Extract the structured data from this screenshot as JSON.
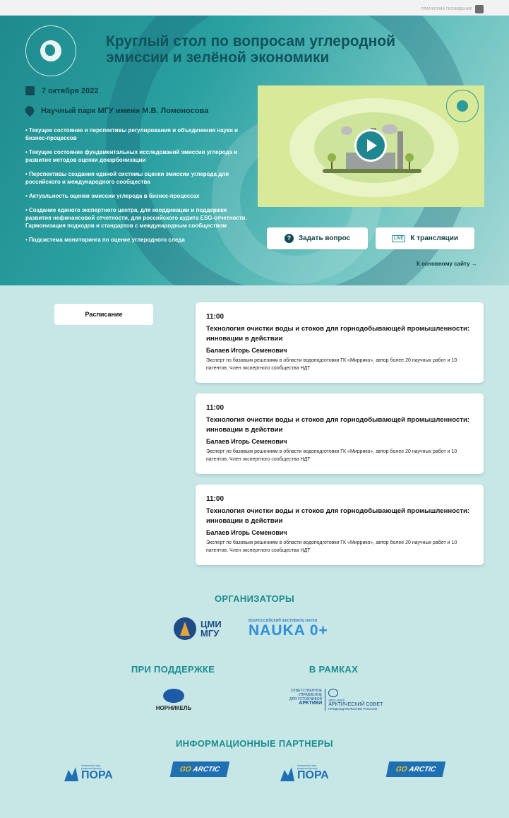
{
  "topbar": {
    "platform_label": "ПЛАТФОРМА ГЕОВИДЕНИЕ"
  },
  "hero": {
    "title": "Круглый стол по вопросам углеродной эмиссии и зелёной экономики",
    "date": "7 октября 2022",
    "place": "Научный парк МГУ имени М.В. Ломоносова",
    "bullets": [
      "Текущее состояние и перспективы регулирования и объединения науки и бизнес-процессов",
      "Текущее состояние фундаментальных исследований эмиссии углерода и развитие методов оценки декарбонизации",
      "Перспективы создания единой системы оценки эмиссии углерода для российского и международного сообщества",
      "Актуальность оценки эмиссии углерода в бизнес-процессах",
      "Создание единого экспертного центра, для координации и поддержки развития нефинансовой отчетности, для российского аудита ESG-отчетности. Гармонизация подходов и стандартов с международным сообществом",
      "Подсистема мониторинга по оценке углеродного следа"
    ],
    "ask_label": "Задать вопрос",
    "live_label": "К трансляции",
    "live_badge": "LIVE",
    "main_site_label": "К основному сайту →"
  },
  "schedule": {
    "tab_label": "Расписание",
    "items": [
      {
        "time": "11:00",
        "title": "Технология очистки воды и стоков для горнодобывающей промышленности: инновации в действии",
        "speaker": "Балаев Игорь Семенович",
        "desc": "Эксперт по базовым решениям в области водоподготовки ГК «Миррико», автор более 20 научных работ и 10 патентов. Член экспертного сообщества НДТ"
      },
      {
        "time": "11:00",
        "title": "Технология очистки воды и стоков для горнодобывающей промышленности: инновации в действии",
        "speaker": "Балаев Игорь Семенович",
        "desc": "Эксперт по базовым решениям в области водоподготовки ГК «Миррико», автор более 20 научных работ и 10 патентов. Член экспертного сообщества НДТ"
      },
      {
        "time": "11:00",
        "title": "Технология очистки воды и стоков для горнодобывающей промышленности: инновации в действии",
        "speaker": "Балаев Игорь Семенович",
        "desc": "Эксперт по базовым решениям в области водоподготовки ГК «Миррико», автор более 20 научных работ и 10 патентов. Член экспертного сообщества НДТ"
      }
    ]
  },
  "sections": {
    "organizers": "ОРГАНИЗАТОРЫ",
    "support": "ПРИ ПОДДЕРЖКЕ",
    "frame": "В РАМКАХ",
    "partners": "ИНФОРМАЦИОННЫЕ ПАРТНЕРЫ"
  },
  "logos": {
    "cmi_line1": "ЦМИ",
    "cmi_line2": "МГУ",
    "nauka_small": "ВСЕРОССИЙСКИЙ ФЕСТИВАЛЬ НАУКИ",
    "nauka_big": "NAUKA 0+",
    "nornikel": "НОРНИКЕЛЬ",
    "arctic_left_1": "ОТВЕТСТВЕННОЕ",
    "arctic_left_2": "УПРАВЛЕНИЕ",
    "arctic_left_3": "ДЛЯ УСТОЙЧИВОЙ",
    "arctic_left_4": "АРКТИКИ",
    "arctic_years": "2021–2023",
    "arctic_title": "АРКТИЧЕСКИЙ СОВЕТ",
    "arctic_sub": "ПРЕДСЕДАТЕЛЬСТВО РОССИИ",
    "pora_small_1": "Проектный офис",
    "pora_small_2": "развития Арктики",
    "pora_big": "ПОРА",
    "go": "GO",
    "arctic_word": "ARCTIC"
  },
  "colors": {
    "accent": "#1c8d91",
    "hero_title": "#11525c",
    "page_bg": "#c7e6e6"
  }
}
